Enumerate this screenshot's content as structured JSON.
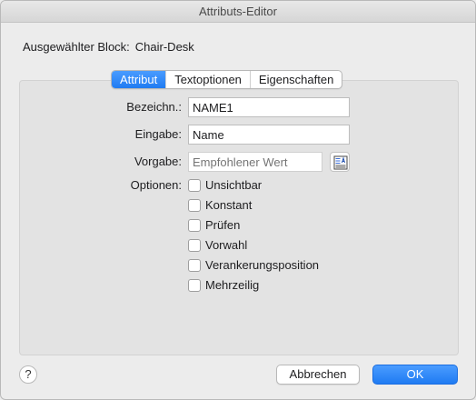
{
  "window": {
    "title": "Attributs-Editor"
  },
  "selected_block": {
    "label": "Ausgewählter Block:",
    "value": "Chair-Desk"
  },
  "tabs": [
    {
      "label": "Attribut",
      "active": true
    },
    {
      "label": "Textoptionen",
      "active": false
    },
    {
      "label": "Eigenschaften",
      "active": false
    }
  ],
  "fields": {
    "tag": {
      "label": "Bezeichn.:",
      "value": "NAME1"
    },
    "prompt": {
      "label": "Eingabe:",
      "value": "Name"
    },
    "default": {
      "label": "Vorgabe:",
      "value": "",
      "placeholder": "Empfohlener Wert",
      "field_button_icon": "insert-field-icon"
    }
  },
  "options": {
    "label": "Optionen:",
    "items": [
      {
        "label": "Unsichtbar",
        "checked": false
      },
      {
        "label": "Konstant",
        "checked": false
      },
      {
        "label": "Prüfen",
        "checked": false
      },
      {
        "label": "Vorwahl",
        "checked": false
      },
      {
        "label": "Verankerungsposition",
        "checked": false
      },
      {
        "label": "Mehrzeilig",
        "checked": false
      }
    ]
  },
  "footer": {
    "help_label": "?",
    "cancel_label": "Abbrechen",
    "ok_label": "OK"
  },
  "colors": {
    "accent": "#1f7bf2",
    "window_bg": "#ececec",
    "panel_bg": "#e3e3e3"
  }
}
